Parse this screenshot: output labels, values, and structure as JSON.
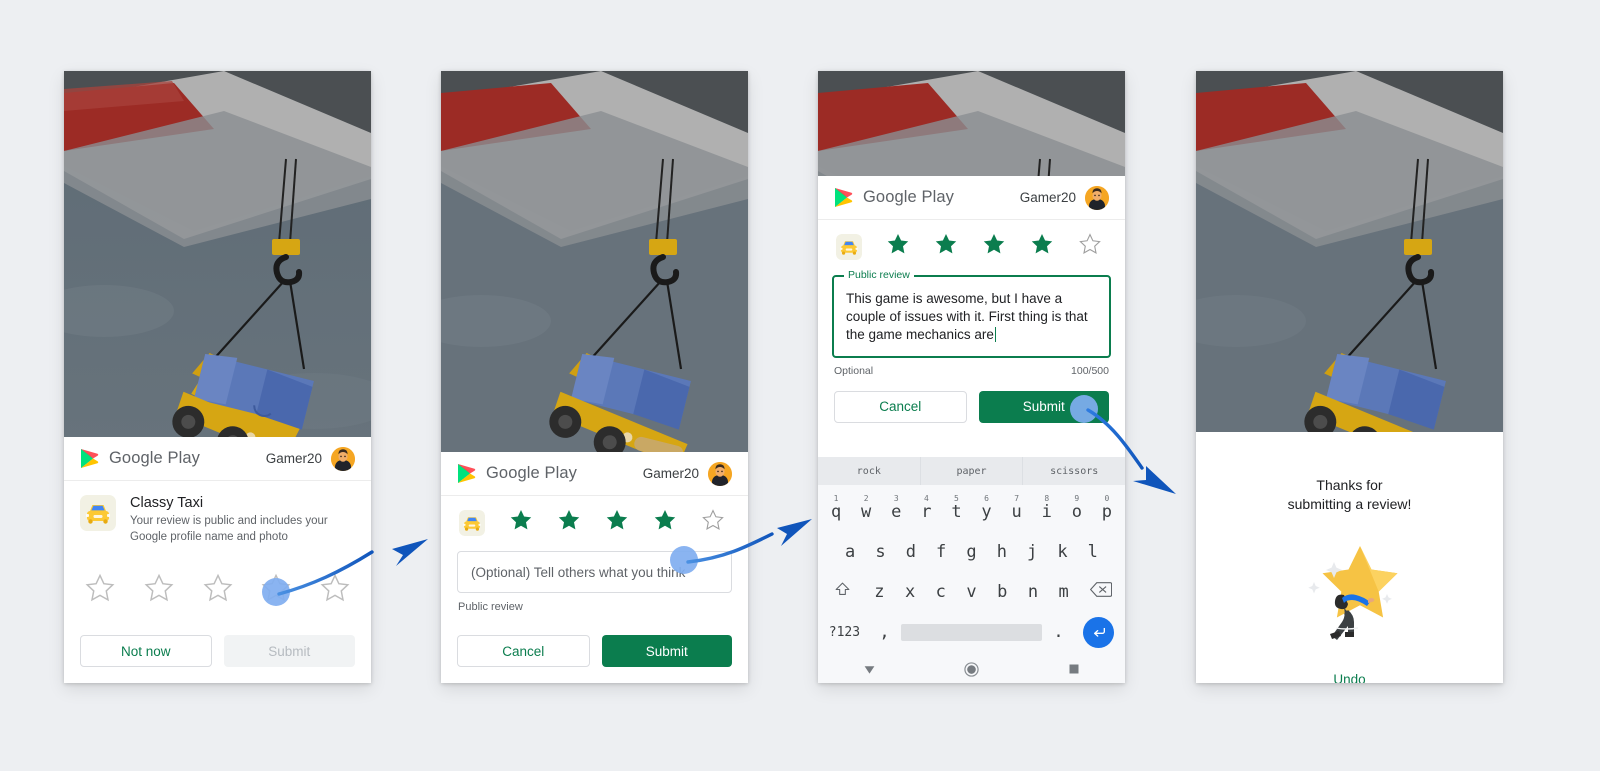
{
  "app": {
    "brand": "Google Play",
    "user": "Gamer20",
    "app_name": "Classy Taxi",
    "app_disclaimer": "Your review is public and includes your Google profile name and photo",
    "brand_color": "#0b7d4e",
    "accent_blue": "#1a73e8",
    "tap_color": "#80aef0"
  },
  "panel1": {
    "stars_total": 5,
    "stars_selected": 0,
    "buttons": {
      "secondary": "Not now",
      "primary": "Submit",
      "primary_disabled": true
    }
  },
  "panel2": {
    "stars_total": 5,
    "stars_selected": 4,
    "input_placeholder": "(Optional) Tell others what you think",
    "helper_text": "Public review",
    "buttons": {
      "secondary": "Cancel",
      "primary": "Submit",
      "primary_disabled": false
    }
  },
  "panel3": {
    "stars_total": 5,
    "stars_selected": 4,
    "field_label": "Public review",
    "review_text": "This game is awesome, but I have a couple of issues with it. First thing is that the game mechanics are",
    "helper_text": "Optional",
    "char_counter": "100/500",
    "buttons": {
      "secondary": "Cancel",
      "primary": "Submit",
      "primary_disabled": false
    },
    "keyboard": {
      "suggestions": [
        "rock",
        "paper",
        "scissors"
      ],
      "row1": [
        {
          "key": "q",
          "num": "1"
        },
        {
          "key": "w",
          "num": "2"
        },
        {
          "key": "e",
          "num": "3"
        },
        {
          "key": "r",
          "num": "4"
        },
        {
          "key": "t",
          "num": "5"
        },
        {
          "key": "y",
          "num": "6"
        },
        {
          "key": "u",
          "num": "7"
        },
        {
          "key": "i",
          "num": "8"
        },
        {
          "key": "o",
          "num": "9"
        },
        {
          "key": "p",
          "num": "0"
        }
      ],
      "row2": [
        "a",
        "s",
        "d",
        "f",
        "g",
        "h",
        "j",
        "k",
        "l"
      ],
      "row3": [
        "z",
        "x",
        "c",
        "v",
        "b",
        "n",
        "m"
      ],
      "shift_icon": "shift-icon",
      "backspace_icon": "backspace-icon",
      "symbols_key": "?123",
      "comma_key": ",",
      "period_key": ".",
      "enter_icon": "enter-icon"
    },
    "navbar": {
      "back": "back-icon",
      "home": "home-icon",
      "recents": "recents-icon"
    }
  },
  "panel4": {
    "thanks_line1": "Thanks for",
    "thanks_line2": "submitting a review!",
    "undo_label": "Undo",
    "illustration": "person-pushing-star-illustration"
  }
}
